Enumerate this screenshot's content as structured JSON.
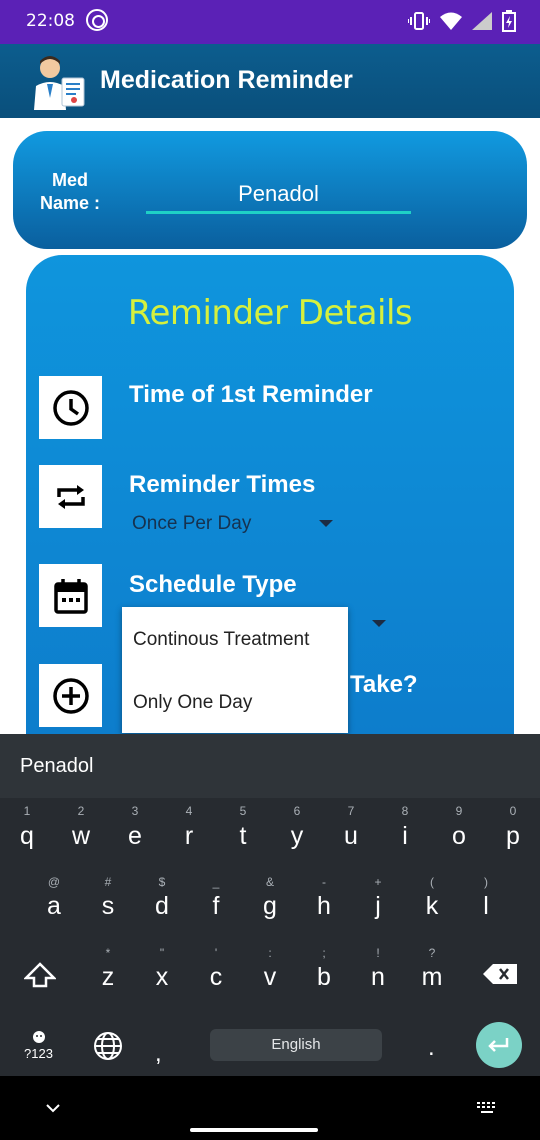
{
  "status_bar": {
    "time": "22:08",
    "icons": [
      "at-sign-icon",
      "vibrate-icon",
      "wifi-icon",
      "signal-icon",
      "battery-icon"
    ]
  },
  "app_bar": {
    "title": "Medication Reminder"
  },
  "med": {
    "label_line1": "Med",
    "label_line2": "Name :",
    "value": "Penadol"
  },
  "reminder": {
    "title": "Reminder Details",
    "first_time_label": "Time of 1st Reminder",
    "times_label": "Reminder Times",
    "times_value": "Once Per Day",
    "schedule_label": "Schedule Type",
    "howmany_label_tail": "Take?"
  },
  "dropdown": {
    "options": [
      "Continous Treatment",
      "Only One Day"
    ]
  },
  "keyboard": {
    "suggestion": "Penadol",
    "row1": [
      "q",
      "w",
      "e",
      "r",
      "t",
      "y",
      "u",
      "i",
      "o",
      "p"
    ],
    "row1_hints": [
      "1",
      "2",
      "3",
      "4",
      "5",
      "6",
      "7",
      "8",
      "9",
      "0"
    ],
    "row2": [
      "a",
      "s",
      "d",
      "f",
      "g",
      "h",
      "j",
      "k",
      "l"
    ],
    "row2_hints": [
      "@",
      "#",
      "$",
      "_",
      "&",
      "-",
      "+",
      "(",
      ")"
    ],
    "row3": [
      "z",
      "x",
      "c",
      "v",
      "b",
      "n",
      "m"
    ],
    "row3_hints": [
      "*",
      "\"",
      "'",
      ":",
      ";",
      "!",
      "?"
    ],
    "sym_label": "?123",
    "comma": ",",
    "space_label": "English",
    "period": "."
  },
  "colors": {
    "status": "#5b21b6",
    "appbar": "#0a5a8a",
    "card": "#0f95dd",
    "title_accent": "#d6f03d",
    "underline": "#1fd0c6",
    "enter": "#7bd2c6"
  }
}
